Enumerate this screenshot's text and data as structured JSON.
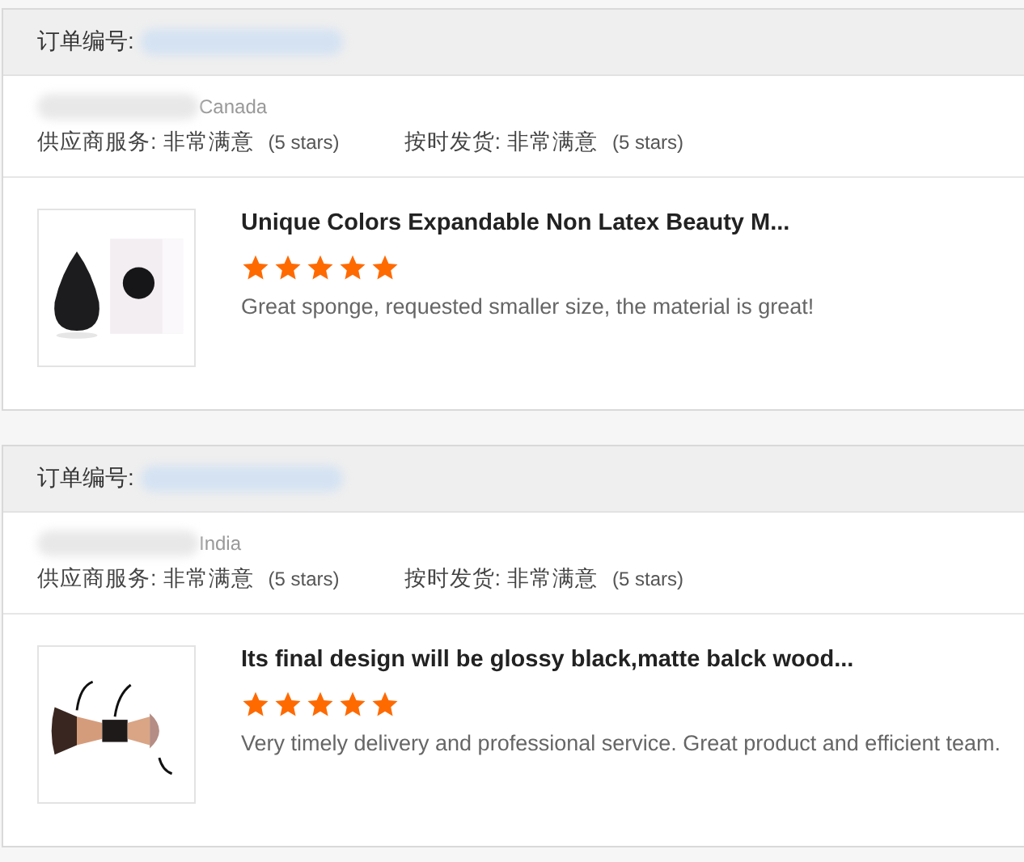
{
  "orders": [
    {
      "order_label": "订单编号:",
      "country": "Canada",
      "ratings": [
        {
          "label": "供应商服务:",
          "value": "非常满意",
          "note": "(5 stars)"
        },
        {
          "label": "按时发货:",
          "value": "非常满意",
          "note": "(5 stars)"
        }
      ],
      "product": {
        "title": "Unique Colors Expandable Non Latex Beauty M...",
        "stars": 5,
        "review": "Great sponge, requested smaller size, the material is great!"
      }
    },
    {
      "order_label": "订单编号:",
      "country": "India",
      "ratings": [
        {
          "label": "供应商服务:",
          "value": "非常满意",
          "note": "(5 stars)"
        },
        {
          "label": "按时发货:",
          "value": "非常满意",
          "note": "(5 stars)"
        }
      ],
      "product": {
        "title": "Its final design will be glossy black,matte balck wood...",
        "stars": 5,
        "review": "Very timely delivery and professional service. Great product and efficient team."
      }
    }
  ]
}
